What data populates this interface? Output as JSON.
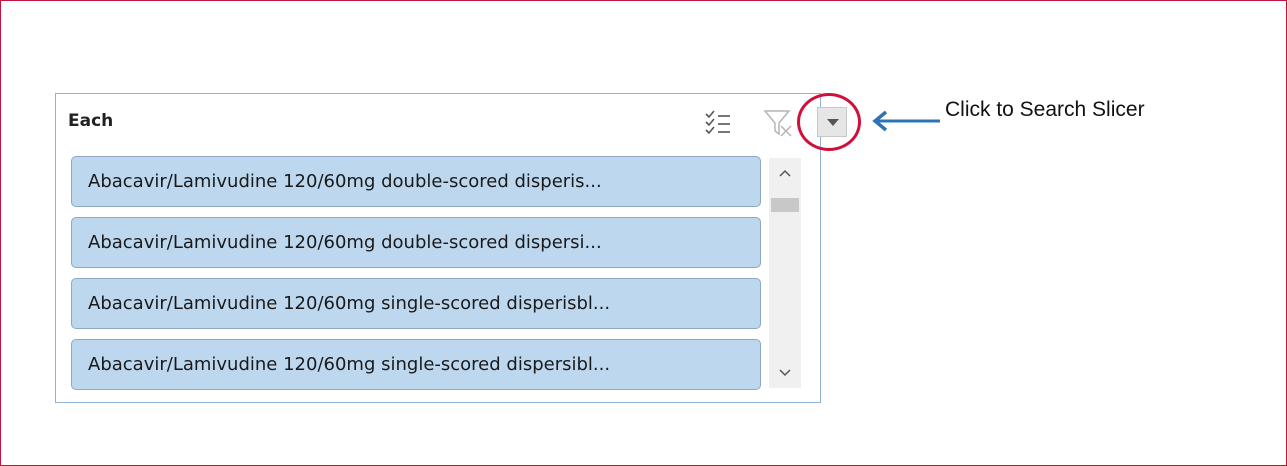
{
  "slicer": {
    "title": "Each",
    "header_icons": {
      "multi_select": "multi-select-icon",
      "clear_filter": "clear-filter-icon",
      "dropdown": "chevron-down-icon"
    },
    "items": [
      {
        "label": "Abacavir/Lamivudine 120/60mg double-scored disperis..."
      },
      {
        "label": "Abacavir/Lamivudine 120/60mg double-scored dispersi..."
      },
      {
        "label": "Abacavir/Lamivudine 120/60mg single-scored disperisbl..."
      },
      {
        "label": "Abacavir/Lamivudine 120/60mg single-scored dispersibl..."
      }
    ]
  },
  "annotation": {
    "callout_text": "Click to Search Slicer",
    "highlight_color": "#d0103a",
    "arrow_color": "#2e74b5"
  },
  "colors": {
    "frame_border": "#c0143c",
    "item_fill": "#bdd7ee",
    "slicer_border": "#8fb2d6"
  }
}
